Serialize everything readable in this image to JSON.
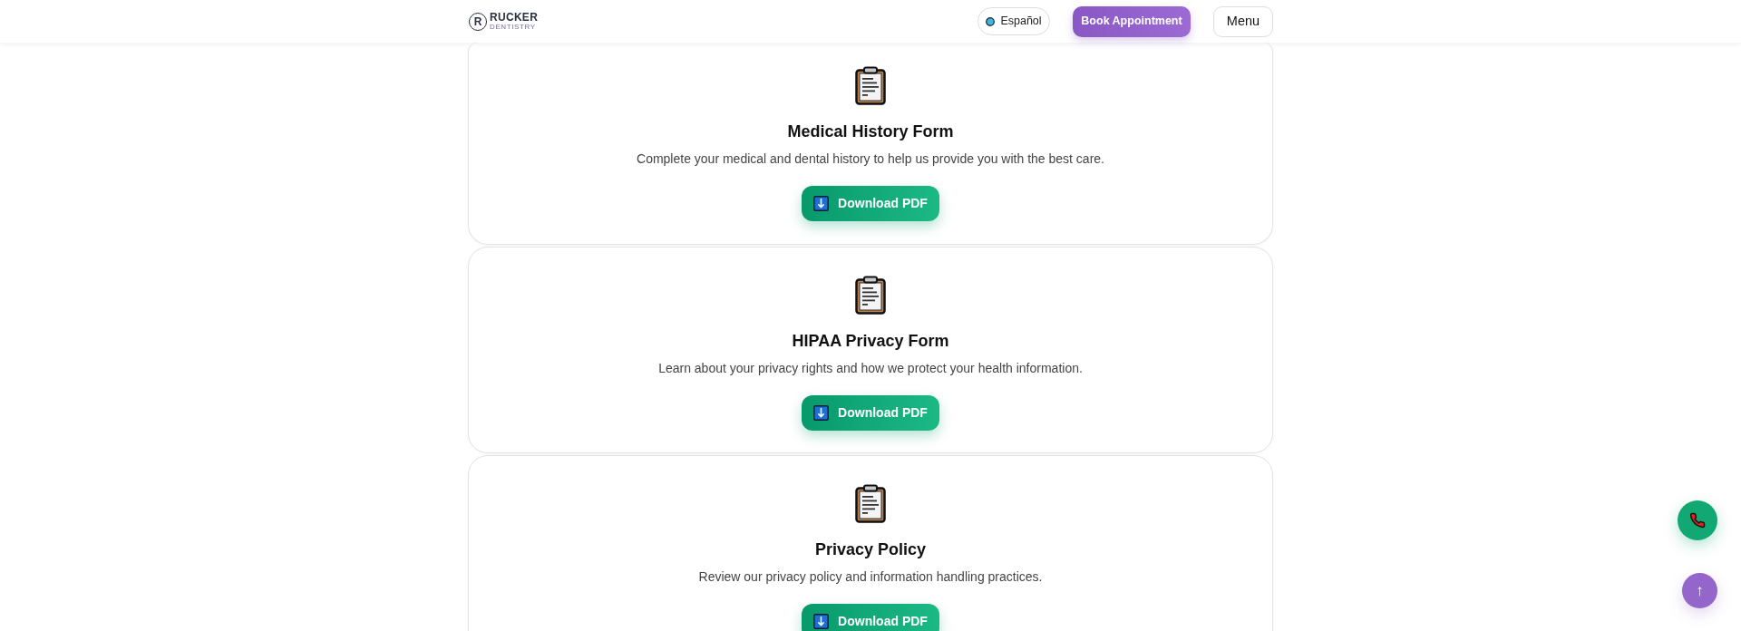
{
  "header": {
    "logo": {
      "mark": "R",
      "name": "RUCKER",
      "tagline": "DENTISTRY"
    },
    "language_button": "Español",
    "book_button": "Book Appointment",
    "menu_button": "Menu"
  },
  "forms": [
    {
      "title": "Medical History Form",
      "description": "Complete your medical and dental history to help us provide you with the best care.",
      "button": "Download PDF"
    },
    {
      "title": "HIPAA Privacy Form",
      "description": "Learn about your privacy rights and how we protect your health information.",
      "button": "Download PDF"
    },
    {
      "title": "Privacy Policy",
      "description": "Review our privacy policy and information handling practices.",
      "button": "Download PDF"
    }
  ],
  "floating_buttons": [
    {
      "kind": "call"
    },
    {
      "kind": "scroll_top",
      "label": "↑"
    }
  ]
}
